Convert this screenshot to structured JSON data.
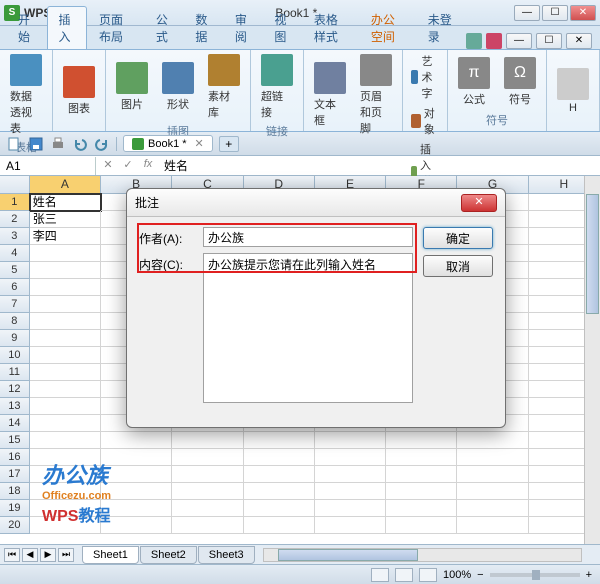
{
  "app": {
    "logo": "S",
    "title": "WPS 表格",
    "document": "Book1 *"
  },
  "window": {
    "min": "—",
    "max": "☐",
    "close": "✕"
  },
  "tabs": {
    "items": [
      "开始",
      "插入",
      "页面布局",
      "公式",
      "数据",
      "审阅",
      "视图",
      "表格样式",
      "办公空间",
      "未登录"
    ],
    "active_index": 1,
    "orange_index": 8
  },
  "ribbon": {
    "groups": [
      {
        "label": "表格",
        "buttons": [
          {
            "label": "数据透视表",
            "color": "#4a90c0"
          }
        ]
      },
      {
        "label": "",
        "buttons": [
          {
            "label": "图表",
            "color": "#d05030"
          }
        ]
      },
      {
        "label": "插图",
        "buttons": [
          {
            "label": "图片",
            "color": "#60a060"
          },
          {
            "label": "形状",
            "color": "#5080b0"
          },
          {
            "label": "素材库",
            "color": "#b08030"
          }
        ]
      },
      {
        "label": "链接",
        "buttons": [
          {
            "label": "超链接",
            "color": "#4aa090"
          }
        ]
      },
      {
        "label": "",
        "buttons": [
          {
            "label": "文本框",
            "color": "#7080a0"
          },
          {
            "label": "页眉和页脚",
            "color": "#888888"
          }
        ]
      },
      {
        "label": "",
        "col": [
          "艺术字",
          "对象",
          "插入附件"
        ],
        "colicons": [
          "#3a7ab0",
          "#b06030",
          "#70a050"
        ]
      },
      {
        "label": "符号",
        "buttons": [
          {
            "label": "公式",
            "color": "#888888",
            "text": "π"
          },
          {
            "label": "符号",
            "color": "#888888",
            "text": "Ω"
          }
        ]
      },
      {
        "label": "",
        "buttons": [
          {
            "label": "H",
            "color": "#cccccc"
          }
        ]
      }
    ]
  },
  "qat": {
    "doc_tab": "Book1 *",
    "add": "+"
  },
  "formula_bar": {
    "name": "A1",
    "value": "姓名"
  },
  "columns": [
    "A",
    "B",
    "C",
    "D",
    "E",
    "F",
    "G",
    "H"
  ],
  "cells": {
    "A1": "姓名",
    "A2": "张三",
    "A3": "李四"
  },
  "row_count": 20,
  "active_cell": "A1",
  "watermark": {
    "line1": "办公族",
    "line2": "Officezu.com",
    "line3a": "WPS",
    "line3b": "教程"
  },
  "dialog": {
    "title": "批注",
    "author_label": "作者(A):",
    "author_value": "办公族",
    "content_label": "内容(C):",
    "content_value": "办公族提示您请在此列输入姓名",
    "ok": "确定",
    "cancel": "取消",
    "close": "✕"
  },
  "sheets": {
    "items": [
      "Sheet1",
      "Sheet2",
      "Sheet3"
    ],
    "active_index": 0
  },
  "status": {
    "zoom": "100%"
  }
}
